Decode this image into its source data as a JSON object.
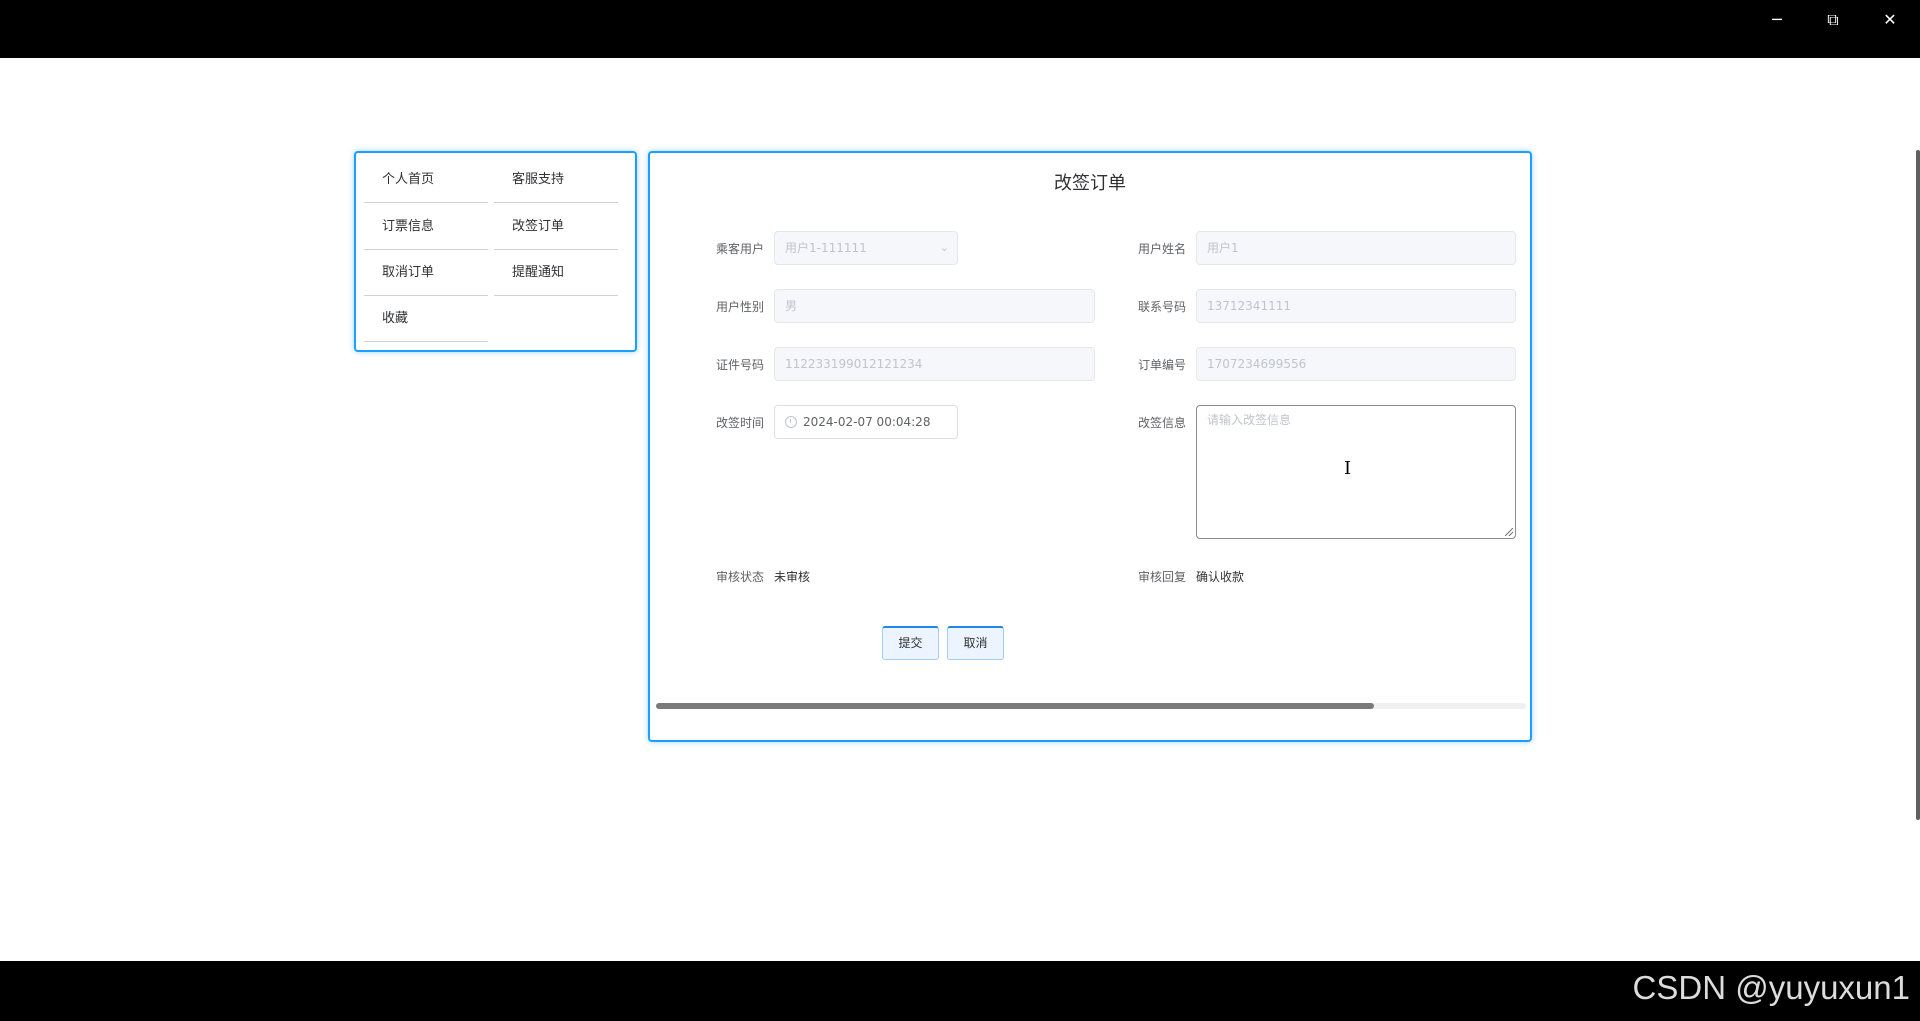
{
  "window": {
    "minimize_icon": "minimize-icon",
    "restore_icon": "restore-icon",
    "close_icon": "close-icon"
  },
  "menu": {
    "items": [
      {
        "label": "个人首页"
      },
      {
        "label": "客服支持"
      },
      {
        "label": "订票信息"
      },
      {
        "label": "改签订单"
      },
      {
        "label": "取消订单"
      },
      {
        "label": "提醒通知"
      },
      {
        "label": "收藏"
      }
    ]
  },
  "form": {
    "title": "改签订单",
    "passenger_label": "乘客用户",
    "passenger_value": "用户1-111111",
    "username_label": "用户姓名",
    "username_value": "用户1",
    "gender_label": "用户性别",
    "gender_value": "男",
    "phone_label": "联系号码",
    "phone_value": "13712341111",
    "id_label": "证件号码",
    "id_value": "112233199012121234",
    "order_label": "订单编号",
    "order_value": "1707234699556",
    "change_time_label": "改签时间",
    "change_time_value": "2024-02-07 00:04:28",
    "change_info_label": "改签信息",
    "change_info_placeholder": "请输入改签信息",
    "review_status_label": "审核状态",
    "review_status_value": "未审核",
    "review_reply_label": "审核回复",
    "review_reply_value": "确认收款",
    "submit_label": "提交",
    "cancel_label": "取消"
  },
  "watermark": "CSDN @yuyuxun1",
  "colors": {
    "accent": "#1e9fff",
    "titlebar": "#000000"
  }
}
